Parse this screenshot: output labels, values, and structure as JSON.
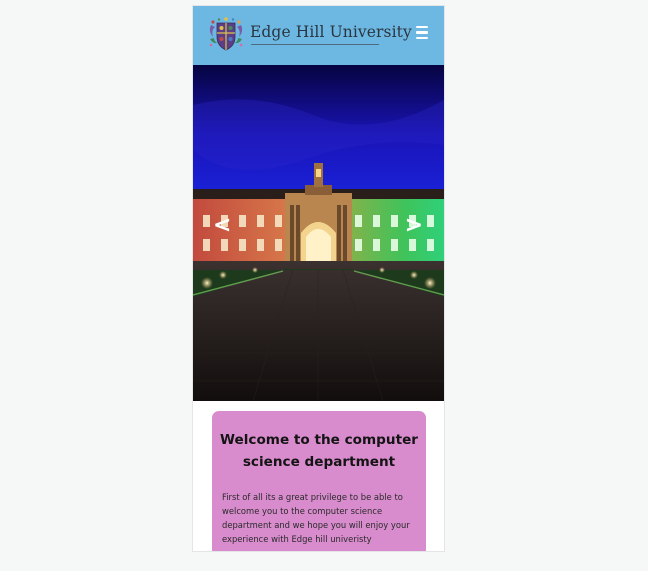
{
  "header": {
    "logo_icon": "university-crest",
    "logo_text": "Edge Hill University",
    "menu_icon": "hamburger-menu-icon",
    "background_color": "#6cb8e2"
  },
  "hero": {
    "prev_label": "<",
    "next_label": ">",
    "sky_color": "#0c0a5e"
  },
  "welcome": {
    "title": "Welcome to the computer science department",
    "body": "First of all its a great privilege to be able to welcome you to the computer science department and we hope you will enjoy your experience with Edge hill univeristy",
    "background_color": "#d88ccd"
  }
}
